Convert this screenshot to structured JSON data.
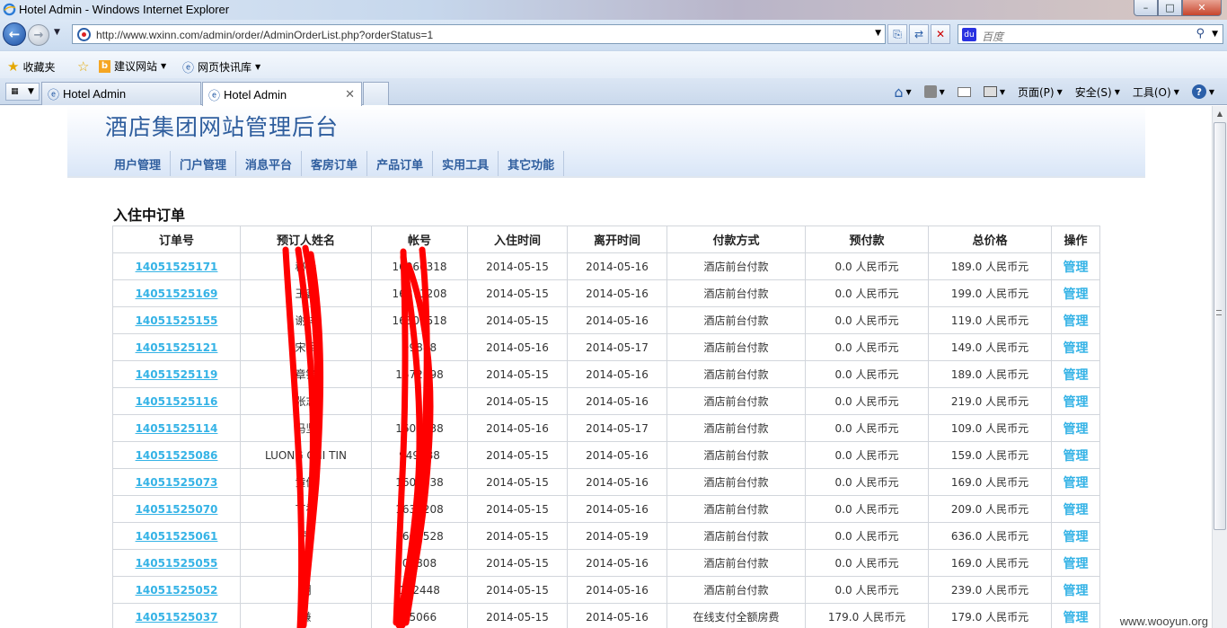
{
  "window": {
    "title": "Hotel Admin - Windows Internet Explorer",
    "buttons": {
      "min": "–",
      "max": "□",
      "close": "✕"
    }
  },
  "address_bar": {
    "url": "http://www.wxinn.com/admin/order/AdminOrderList.php?orderStatus=1",
    "search_placeholder": "百度",
    "search_engine_badge": "du"
  },
  "favorites_bar": {
    "favorites_label": "收藏夹",
    "suggested_sites_label": "建议网站",
    "web_slice_label": "网页快讯库"
  },
  "tabs": [
    {
      "label": "Hotel Admin",
      "active": false
    },
    {
      "label": "Hotel Admin",
      "active": true
    }
  ],
  "command_bar": {
    "page_label": "页面(P)",
    "safety_label": "安全(S)",
    "tools_label": "工具(O)",
    "help_glyph": "?"
  },
  "site": {
    "title": "酒店集团网站管理后台",
    "nav": [
      "用户管理",
      "门户管理",
      "消息平台",
      "客房订单",
      "产品订单",
      "实用工具",
      "其它功能"
    ]
  },
  "section_title": "入住中订单",
  "table": {
    "columns": [
      "订单号",
      "预订人姓名",
      "帐号",
      "入住时间",
      "离开时间",
      "付款方式",
      "预付款",
      "总价格",
      "操作"
    ],
    "rows": [
      [
        "14051525171",
        "秘晨",
        "16060318",
        "2014-05-15",
        "2014-05-16",
        "酒店前台付款",
        "0.0 人民币元",
        "189.0 人民币元",
        "管理"
      ],
      [
        "14051525169",
        "王鑫",
        "16871208",
        "2014-05-15",
        "2014-05-16",
        "酒店前台付款",
        "0.0 人民币元",
        "199.0 人民币元",
        "管理"
      ],
      [
        "14051525155",
        "谢祥",
        "16308518",
        "2014-05-15",
        "2014-05-16",
        "酒店前台付款",
        "0.0 人民币元",
        "119.0 人民币元",
        "管理"
      ],
      [
        "14051525121",
        "宋军",
        "99888",
        "2014-05-16",
        "2014-05-17",
        "酒店前台付款",
        "0.0 人民币元",
        "149.0 人民币元",
        "管理"
      ],
      [
        "14051525119",
        "章锋",
        "1672098",
        "2014-05-15",
        "2014-05-16",
        "酒店前台付款",
        "0.0 人民币元",
        "189.0 人民币元",
        "管理"
      ],
      [
        "14051525116",
        "张志",
        "",
        "2014-05-15",
        "2014-05-16",
        "酒店前台付款",
        "0.0 人民币元",
        "219.0 人民币元",
        "管理"
      ],
      [
        "14051525114",
        "冯坚",
        "1607538",
        "2014-05-16",
        "2014-05-17",
        "酒店前台付款",
        "0.0 人民币元",
        "109.0 人民币元",
        "管理"
      ],
      [
        "14051525086",
        "LUONG CHI TIN",
        "949888",
        "2014-05-15",
        "2014-05-16",
        "酒店前台付款",
        "0.0 人民币元",
        "159.0 人民币元",
        "管理"
      ],
      [
        "14051525073",
        "黄伦",
        "1604938",
        "2014-05-15",
        "2014-05-16",
        "酒店前台付款",
        "0.0 人民币元",
        "169.0 人民币元",
        "管理"
      ],
      [
        "14051525070",
        "丁祥",
        "1639208",
        "2014-05-15",
        "2014-05-16",
        "酒店前台付款",
        "0.0 人民币元",
        "209.0 人民币元",
        "管理"
      ],
      [
        "14051525061",
        "丹",
        "1608528",
        "2014-05-15",
        "2014-05-19",
        "酒店前台付款",
        "0.0 人民币元",
        "636.0 人民币元",
        "管理"
      ],
      [
        "14051525055",
        "绅",
        "00808",
        "2014-05-15",
        "2014-05-16",
        "酒店前台付款",
        "0.0 人民币元",
        "169.0 人民币元",
        "管理"
      ],
      [
        "14051525052",
        "明",
        "142448",
        "2014-05-15",
        "2014-05-16",
        "酒店前台付款",
        "0.0 人民币元",
        "239.0 人民币元",
        "管理"
      ],
      [
        "14051525037",
        "谦",
        "55066",
        "2014-05-15",
        "2014-05-16",
        "在线支付全额房费",
        "179.0 人民币元",
        "179.0 人民币元",
        "管理"
      ]
    ]
  },
  "watermark": "www.wooyun.org",
  "colors": {
    "link": "#35b3e6",
    "site_title": "#2f5e9e",
    "redaction": "#ff0000"
  }
}
